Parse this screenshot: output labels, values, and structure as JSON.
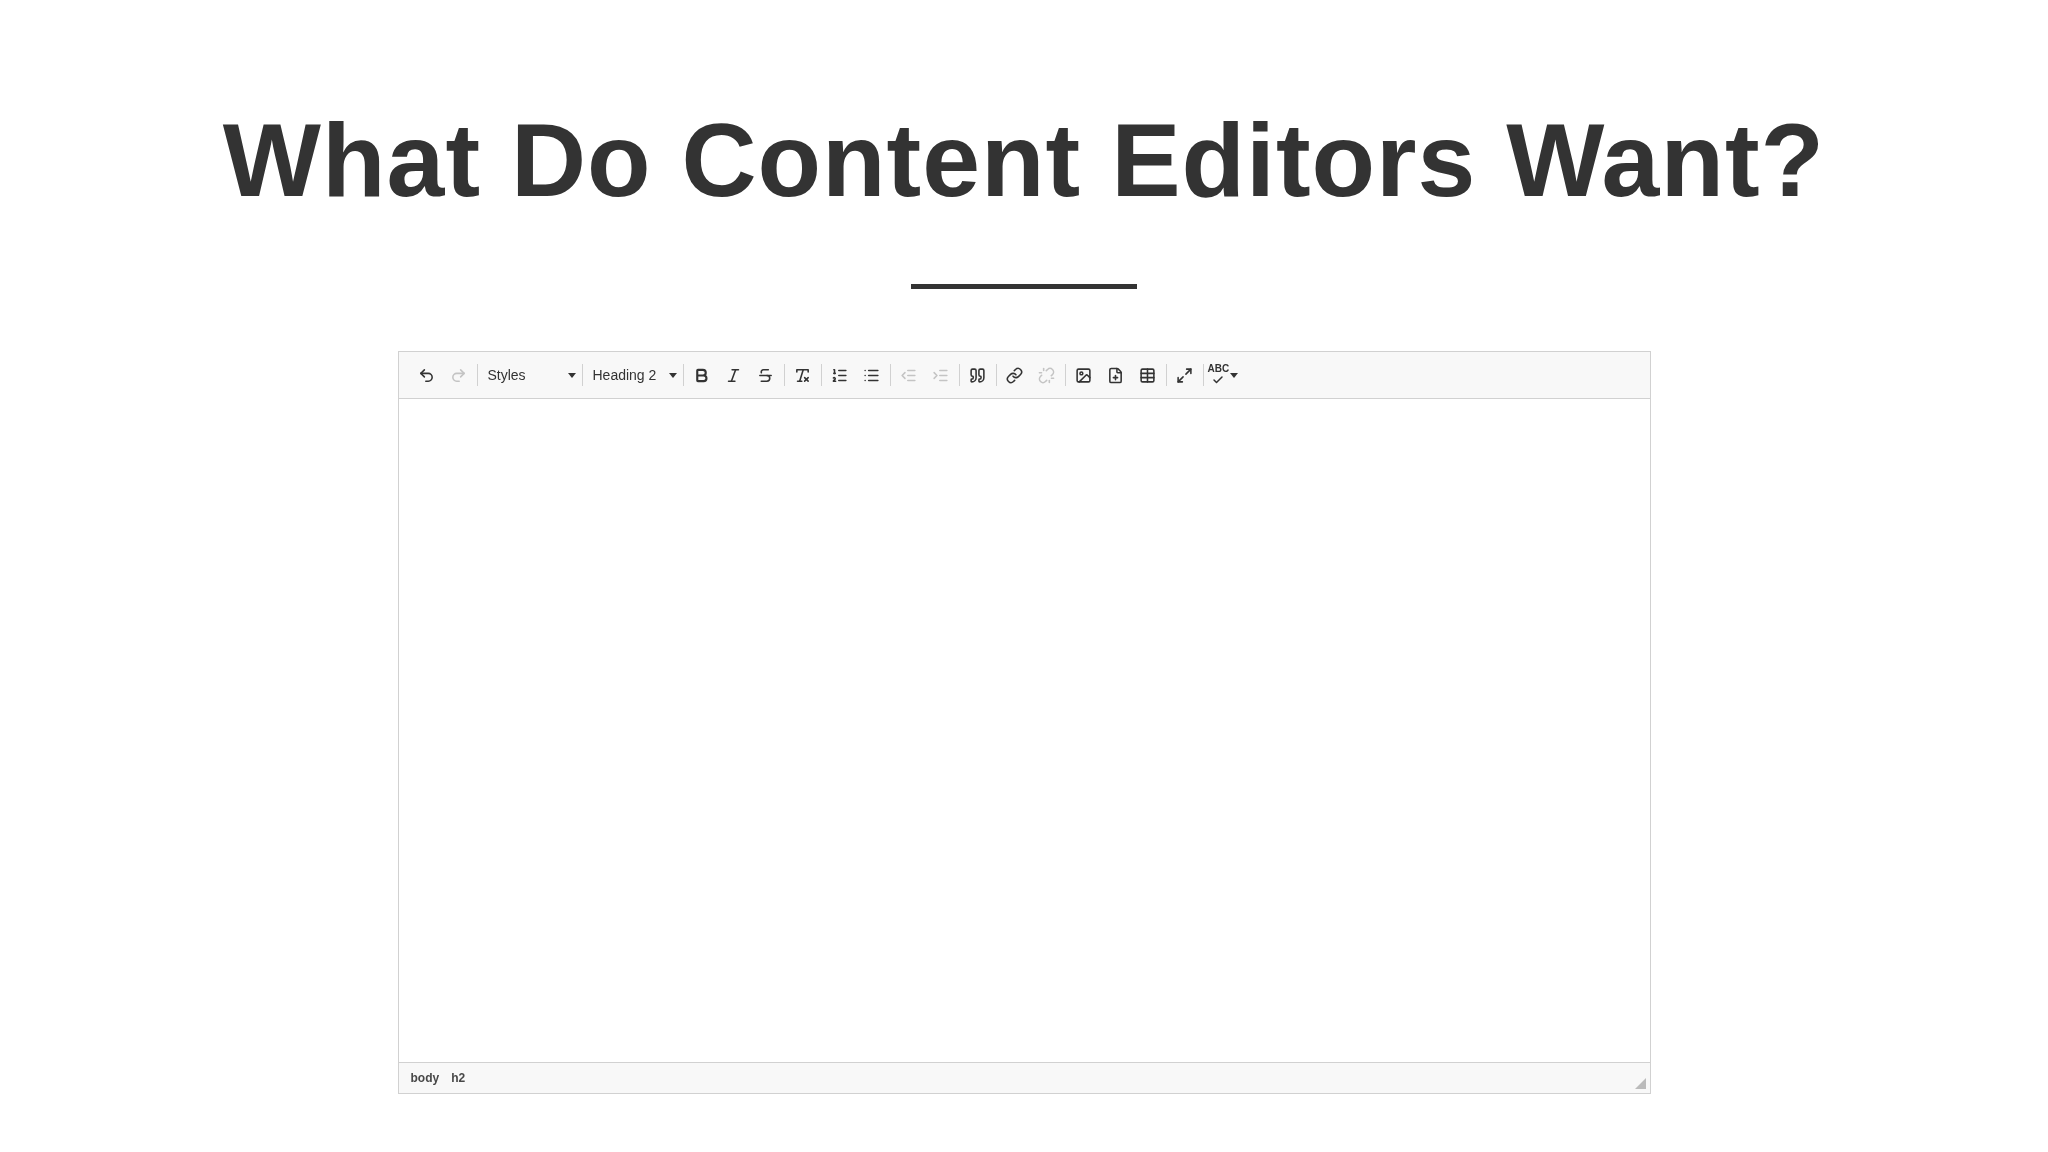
{
  "slide": {
    "title": "What Do Content Editors Want?"
  },
  "editor": {
    "toolbar": [
      {
        "kind": "buttons",
        "items": [
          {
            "kind": "undo",
            "disabled": false
          },
          {
            "kind": "redo",
            "disabled": true
          }
        ]
      },
      {
        "kind": "combo",
        "label": "Styles"
      },
      {
        "kind": "combo",
        "label": "Heading 2"
      },
      {
        "kind": "buttons",
        "items": [
          {
            "kind": "bold",
            "disabled": false
          },
          {
            "kind": "italic",
            "disabled": false
          },
          {
            "kind": "strike",
            "disabled": false
          }
        ]
      },
      {
        "kind": "buttons",
        "items": [
          {
            "kind": "clear",
            "disabled": false
          }
        ]
      },
      {
        "kind": "buttons",
        "items": [
          {
            "kind": "numbered",
            "disabled": false
          },
          {
            "kind": "bulleted",
            "disabled": false
          }
        ]
      },
      {
        "kind": "buttons",
        "items": [
          {
            "kind": "outdent",
            "disabled": true
          },
          {
            "kind": "indent",
            "disabled": true
          }
        ]
      },
      {
        "kind": "buttons",
        "items": [
          {
            "kind": "quote",
            "disabled": false
          }
        ]
      },
      {
        "kind": "buttons",
        "items": [
          {
            "kind": "link",
            "disabled": false
          },
          {
            "kind": "unlink",
            "disabled": true
          }
        ]
      },
      {
        "kind": "buttons",
        "items": [
          {
            "kind": "image",
            "disabled": false
          },
          {
            "kind": "embed",
            "disabled": false
          },
          {
            "kind": "table",
            "disabled": false
          }
        ]
      },
      {
        "kind": "buttons",
        "items": [
          {
            "kind": "maximize",
            "disabled": false
          }
        ]
      },
      {
        "kind": "spell",
        "label": "ABC"
      }
    ],
    "path": [
      "body",
      "h2"
    ]
  }
}
